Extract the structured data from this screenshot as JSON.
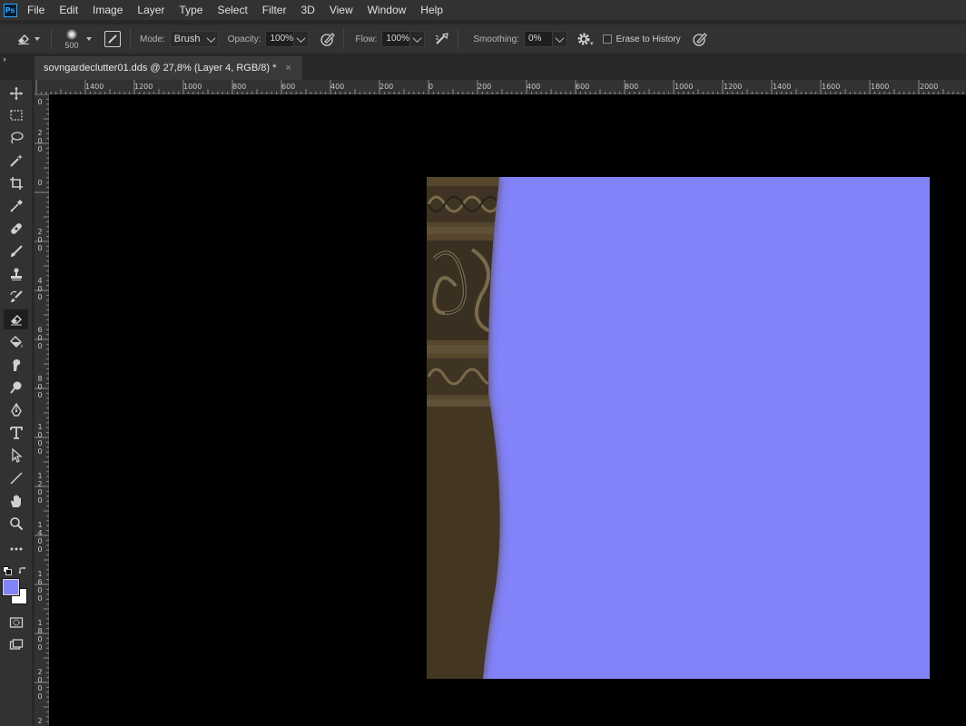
{
  "app": {
    "logo_text": "Ps"
  },
  "menu": [
    "File",
    "Edit",
    "Image",
    "Layer",
    "Type",
    "Select",
    "Filter",
    "3D",
    "View",
    "Window",
    "Help"
  ],
  "options": {
    "brush_size": "500",
    "mode_label": "Mode:",
    "mode_value": "Brush",
    "opacity_label": "Opacity:",
    "opacity_value": "100%",
    "flow_label": "Flow:",
    "flow_value": "100%",
    "smoothing_label": "Smoothing:",
    "smoothing_value": "0%",
    "erase_history_label": "Erase to History",
    "erase_history_checked": false
  },
  "document_tab": {
    "title": "sovngardeclutter01.dds @ 27,8% (Layer 4, RGB/8) *",
    "close": "×"
  },
  "ruler": {
    "horizontal": [
      "1400",
      "1200",
      "1000",
      "800",
      "600",
      "400",
      "200",
      "0",
      "200",
      "400",
      "600",
      "800",
      "1000",
      "1200",
      "1400",
      "1600",
      "1800",
      "2000"
    ],
    "vertical": [
      "0",
      "200",
      "0",
      "200",
      "400",
      "600",
      "800",
      "1000",
      "1200",
      "1400",
      "1600",
      "1800",
      "2000",
      "2"
    ]
  },
  "colors": {
    "foreground": "#8282f9",
    "background": "#ffffff",
    "layer_fill": "#8282f9",
    "canvas_bg": "#000000"
  },
  "tools": [
    "move-tool",
    "marquee-tool",
    "lasso-tool",
    "magic-wand-tool",
    "crop-tool",
    "eyedropper-tool",
    "healing-brush-tool",
    "brush-tool",
    "clone-stamp-tool",
    "history-brush-tool",
    "eraser-tool",
    "paint-bucket-tool",
    "smudge-tool",
    "dodge-tool",
    "pen-tool",
    "type-tool",
    "path-selection-tool",
    "line-tool",
    "hand-tool",
    "zoom-tool",
    "more-tools"
  ]
}
